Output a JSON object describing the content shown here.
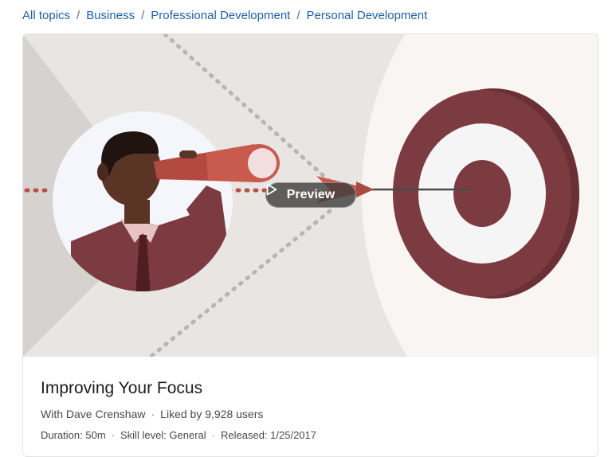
{
  "breadcrumb": {
    "items": [
      {
        "label": "All topics"
      },
      {
        "label": "Business"
      },
      {
        "label": "Professional Development"
      },
      {
        "label": "Personal Development"
      }
    ],
    "separator": "/"
  },
  "hero": {
    "preview_label": "Preview",
    "icons": [
      "play-icon"
    ]
  },
  "course": {
    "title": "Improving Your Focus",
    "author": "With Dave Crenshaw",
    "likes": "Liked by 9,928 users",
    "duration": "Duration: 50m",
    "skill_level": "Skill level: General",
    "released": "Released: 1/25/2017",
    "meta_separator": "·"
  },
  "colors": {
    "link": "#1f5fa8",
    "target_red": "#7c3b40",
    "target_dark": "#6a3035",
    "background": "#e8e5e2"
  }
}
